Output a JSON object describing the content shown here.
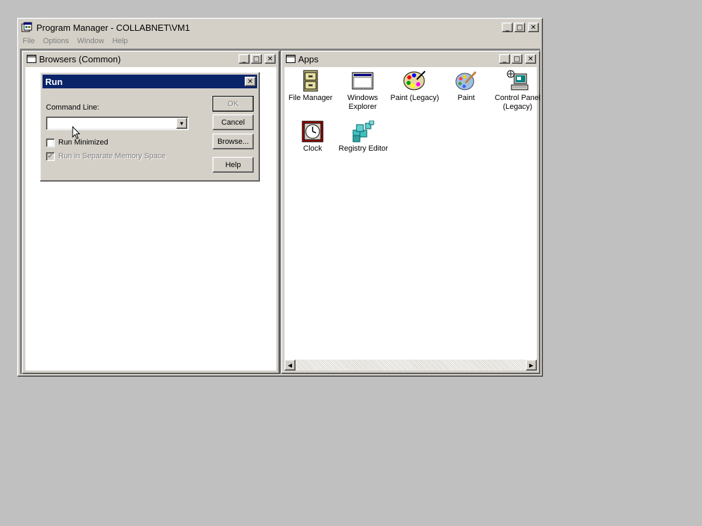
{
  "program_manager": {
    "title": "Program Manager - COLLABNET\\VM1",
    "menu": [
      "File",
      "Options",
      "Window",
      "Help"
    ]
  },
  "browsers_window": {
    "title": "Browsers (Common)"
  },
  "apps_window": {
    "title": "Apps",
    "icons": [
      {
        "label": "File Manager",
        "icon": "file-cabinet-icon"
      },
      {
        "label": "Windows Explorer",
        "icon": "explorer-window-icon"
      },
      {
        "label": "Paint (Legacy)",
        "icon": "palette-icon"
      },
      {
        "label": "Paint",
        "icon": "palette-brush-icon"
      },
      {
        "label": "Control Panel (Legacy)",
        "icon": "control-panel-icon"
      },
      {
        "label": "Clock",
        "icon": "clock-icon"
      },
      {
        "label": "Registry Editor",
        "icon": "registry-cubes-icon"
      }
    ]
  },
  "run_dialog": {
    "title": "Run",
    "command_line_label": "Command Line:",
    "command_line_value": "",
    "run_minimized_label": "Run Minimized",
    "run_minimized_checked": false,
    "separate_memory_label": "Run in Separate Memory Space",
    "separate_memory_checked": true,
    "ok_label": "OK",
    "cancel_label": "Cancel",
    "browse_label": "Browse...",
    "help_label": "Help"
  },
  "window_controls": {
    "minimize": "minimize-icon",
    "maximize": "maximize-icon",
    "close": "close-icon"
  },
  "colors": {
    "desktop": "#c0c0c0",
    "active_title": "#0a246a",
    "face": "#d4d0c8"
  }
}
